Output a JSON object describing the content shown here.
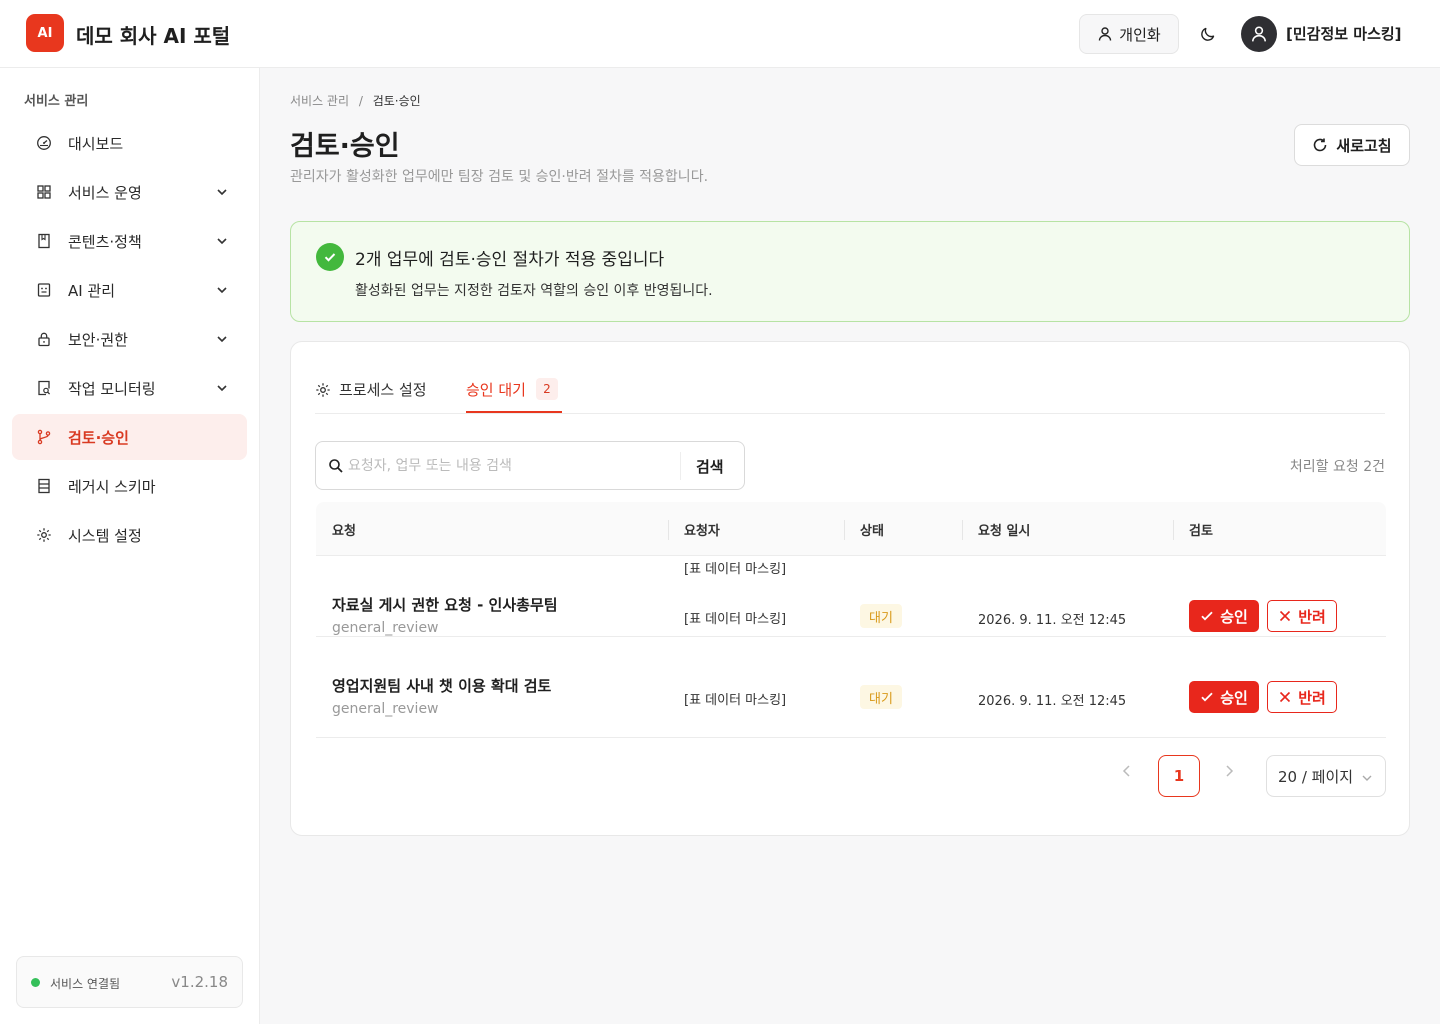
{
  "header": {
    "logo_text": "AI",
    "title": "데모 회사 AI 포털",
    "personal_label": "개인화",
    "user_name": "[민감정보 마스킹]"
  },
  "sidebar": {
    "section_label": "서비스 관리",
    "items": [
      {
        "label": "대시보드",
        "icon": "dashboard-gauge-icon",
        "expandable": false
      },
      {
        "label": "서비스 운영",
        "icon": "grid-icon",
        "expandable": true
      },
      {
        "label": "콘텐츠·정책",
        "icon": "book-icon",
        "expandable": true
      },
      {
        "label": "AI 관리",
        "icon": "robot-icon",
        "expandable": true
      },
      {
        "label": "보안·권한",
        "icon": "lock-icon",
        "expandable": true
      },
      {
        "label": "작업 모니터링",
        "icon": "file-search-icon",
        "expandable": true
      },
      {
        "label": "검토·승인",
        "icon": "branch-icon",
        "expandable": false,
        "active": true
      },
      {
        "label": "레거시 스키마",
        "icon": "database-icon",
        "expandable": false
      },
      {
        "label": "시스템 설정",
        "icon": "gear-icon",
        "expandable": false
      }
    ],
    "status_text": "서비스 연결됨",
    "version": "v1.2.18"
  },
  "breadcrumb": {
    "parent": "서비스 관리",
    "separator": "/",
    "current": "검토·승인"
  },
  "page": {
    "title": "검토·승인",
    "description": "관리자가 활성화한 업무에만 팀장 검토 및 승인·반려 절차를 적용합니다.",
    "refresh_label": "새로고침"
  },
  "alert": {
    "title": "2개 업무에 검토·승인 절차가 적용 중입니다",
    "description": "활성화된 업무는 지정한 검토자 역할의 승인 이후 반영됩니다."
  },
  "tabs": {
    "process_label": "프로세스 설정",
    "pending_label": "승인 대기",
    "pending_count": "2"
  },
  "search": {
    "placeholder": "요청자, 업무 또는 내용 검색",
    "value": "",
    "button_label": "검색",
    "count_text": "처리할 요청 2건"
  },
  "table": {
    "columns": [
      "요청",
      "요청자",
      "상태",
      "요청 일시",
      "검토"
    ],
    "rows": [
      {
        "extra_line": "[표 데이터 마스킹]",
        "title": "자료실 게시 권한 요청 - 인사총무팀",
        "type": "general_review",
        "requester": "[표 데이터 마스킹]",
        "status": "대기",
        "date": "2026. 9. 11. 오전 12:45",
        "approve": "승인",
        "reject": "반려"
      },
      {
        "title": "영업지원팀 사내 챗 이용 확대 검토",
        "type": "general_review",
        "requester": "[표 데이터 마스킹]",
        "status": "대기",
        "date": "2026. 9. 11. 오전 12:45",
        "approve": "승인",
        "reject": "반려"
      }
    ]
  },
  "pagination": {
    "current": "1",
    "page_size": "20 / 페이지"
  },
  "colors": {
    "accent": "#e8371e",
    "success": "#43b83d",
    "pending": "#d99a1a"
  }
}
